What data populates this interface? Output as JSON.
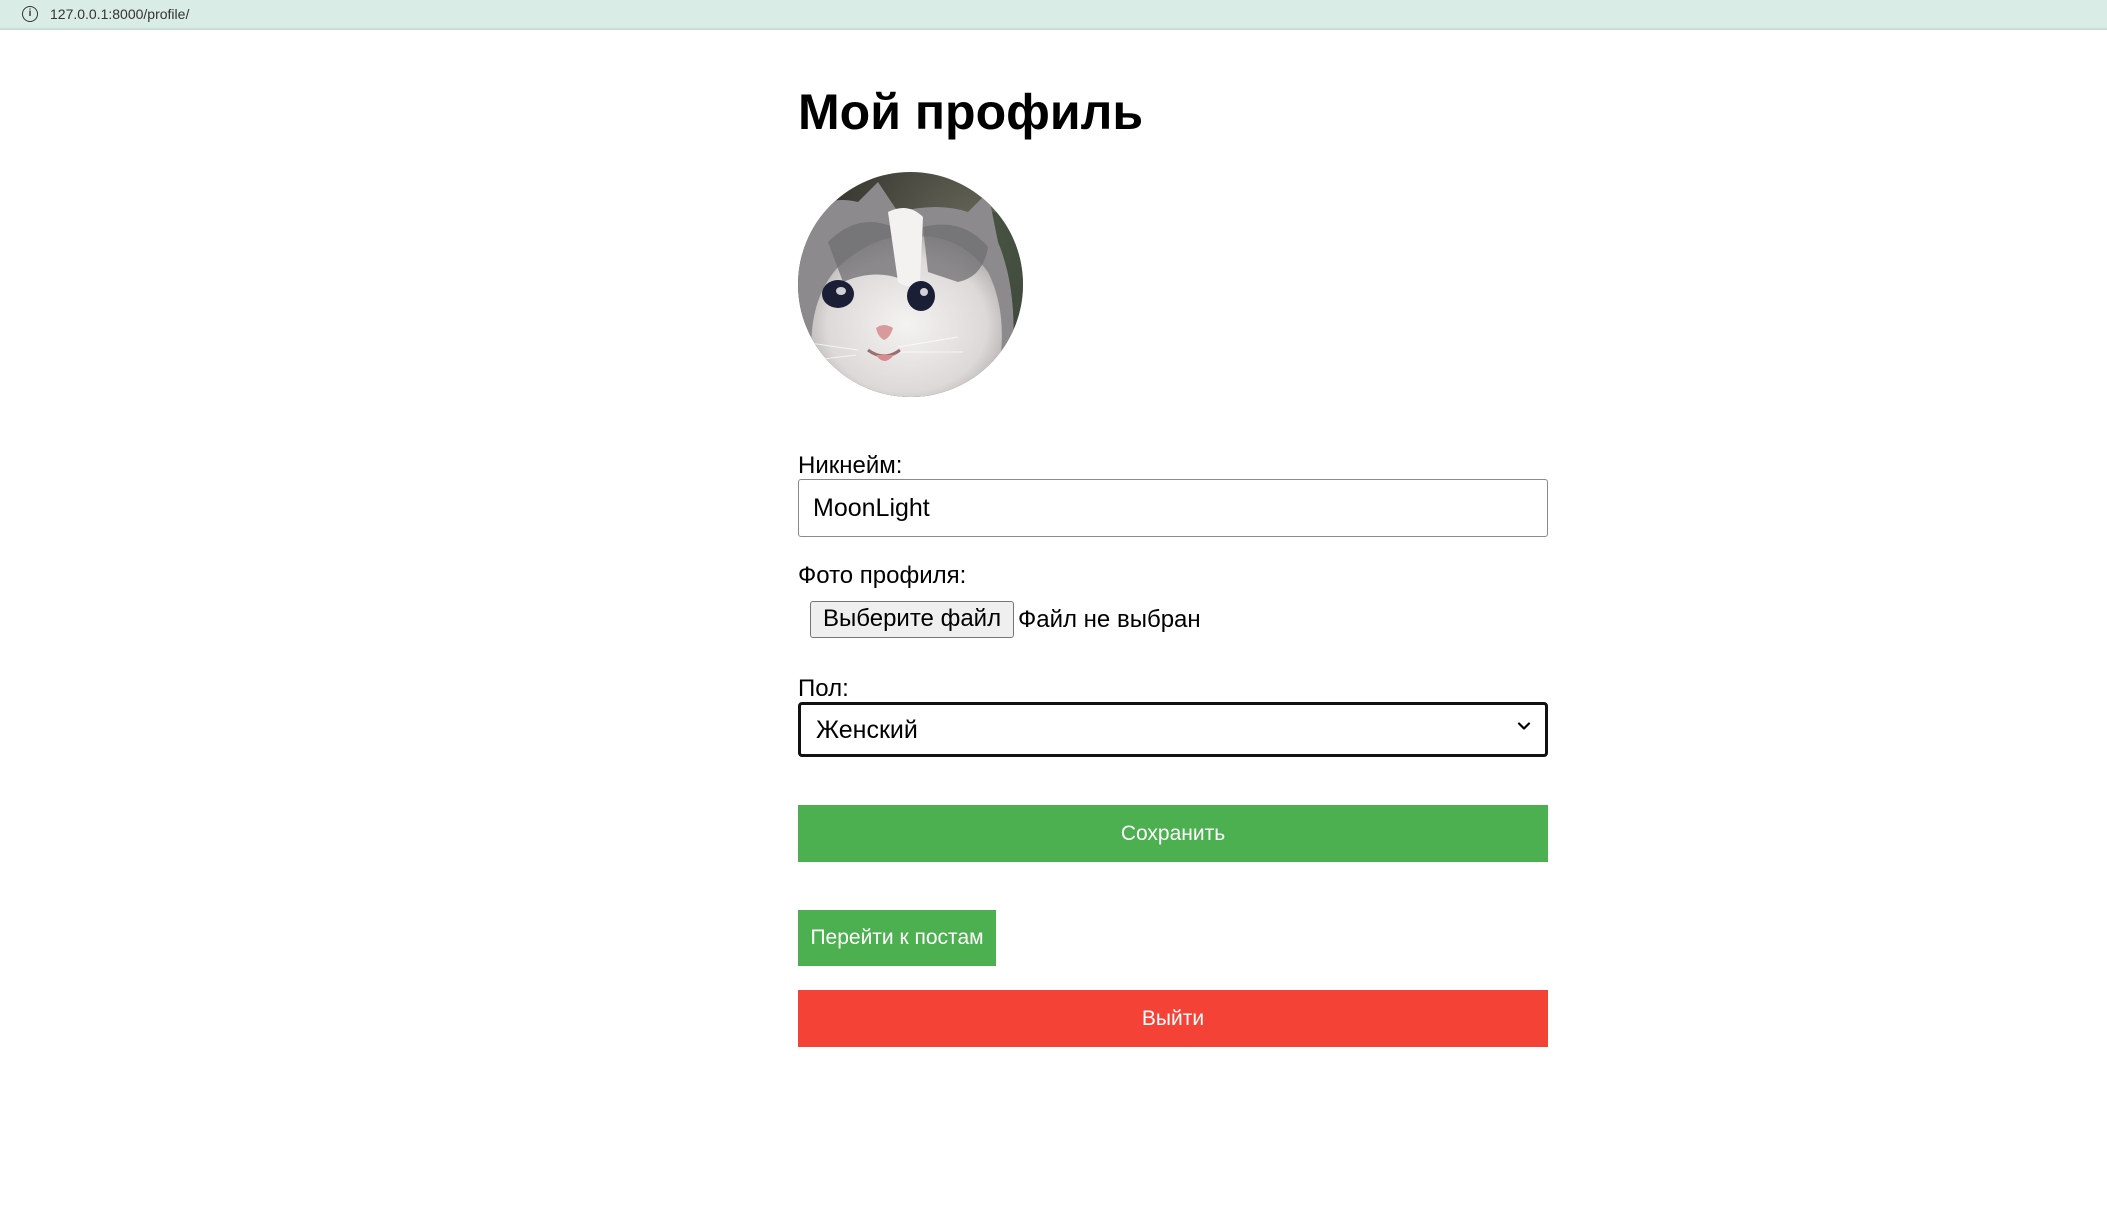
{
  "browser": {
    "url": "127.0.0.1:8000/profile/",
    "info_icon": "info-circle-icon"
  },
  "page": {
    "title": "Мой профиль"
  },
  "avatar": {
    "alt": "kitten-avatar"
  },
  "form": {
    "nickname_label": "Никнейм:",
    "nickname_value": "MoonLight",
    "photo_label": "Фото профиля:",
    "file_button_label": "Выберите файл",
    "file_status": "Файл не выбран",
    "gender_label": "Пол:",
    "gender_value": "Женский",
    "save_label": "Сохранить"
  },
  "actions": {
    "posts_label": "Перейти к постам",
    "logout_label": "Выйти"
  },
  "colors": {
    "primary_green": "#4caf50",
    "danger_red": "#f44336",
    "url_bar_bg": "#d9ece6"
  }
}
